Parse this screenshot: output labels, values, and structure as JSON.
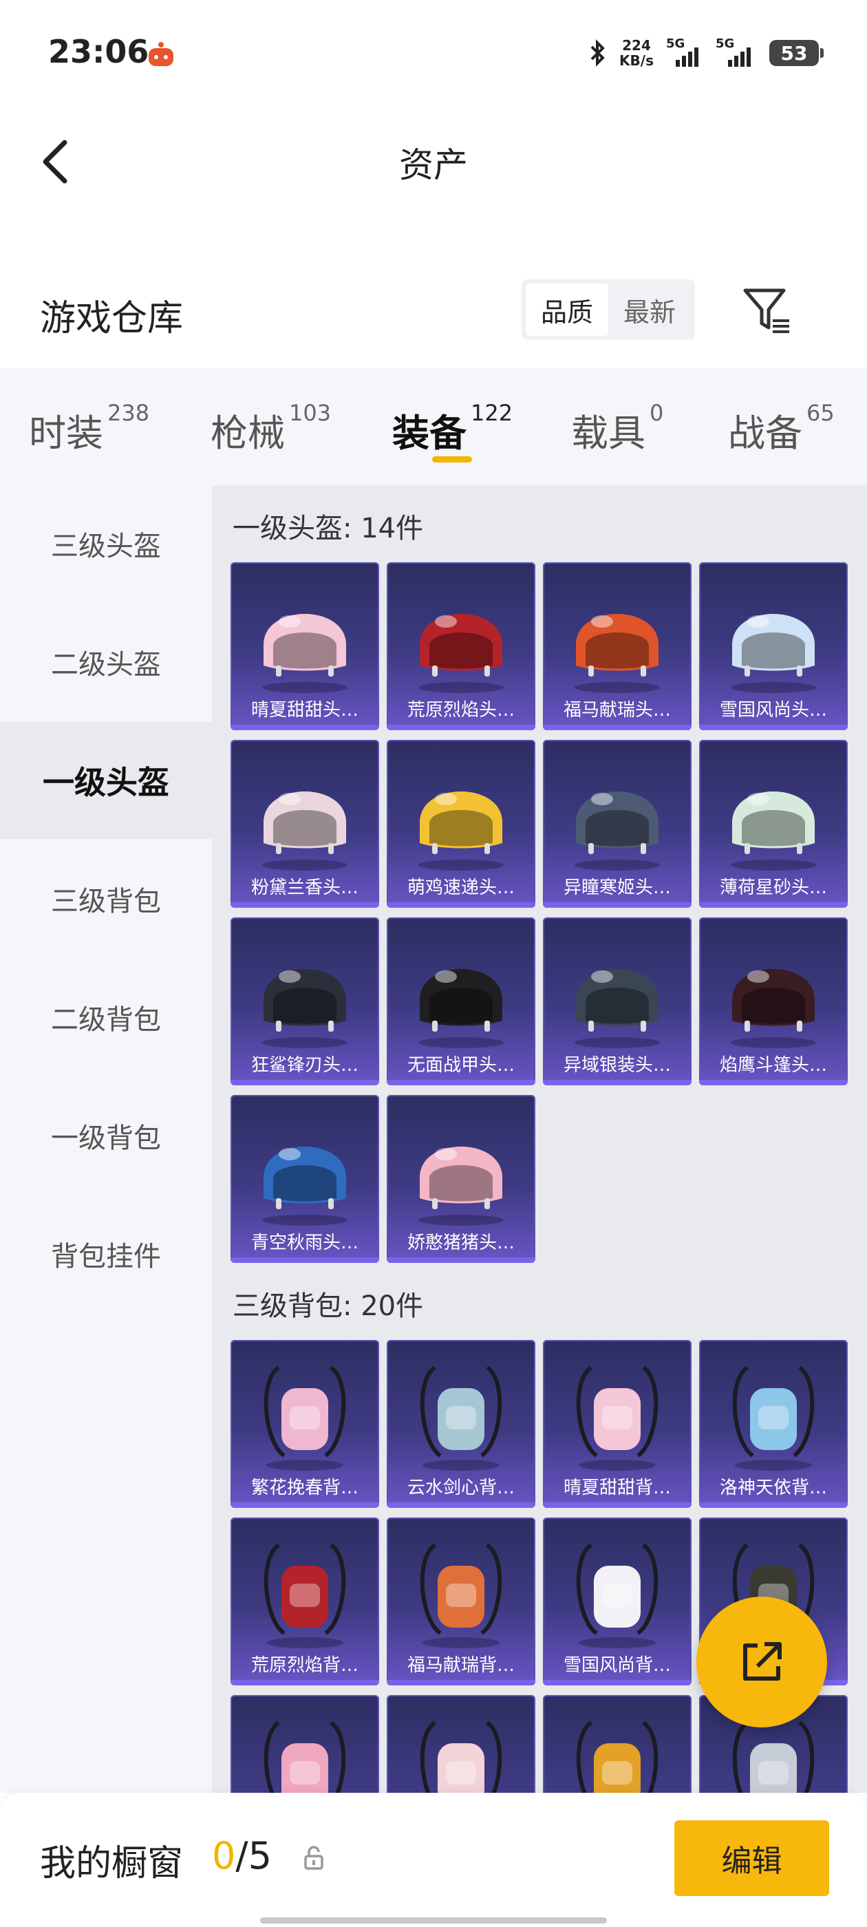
{
  "status_bar": {
    "time": "23:06",
    "speed_value": "224",
    "speed_unit": "KB/s",
    "sim1_label": "5G",
    "sim2_label": "5G",
    "battery": "53",
    "icons": [
      "app-notification-icon",
      "bluetooth-icon",
      "signal-icon",
      "battery-icon"
    ]
  },
  "header": {
    "title": "资产",
    "back_icon": "chevron-left-icon"
  },
  "warehouse": {
    "title": "游戏仓库",
    "sort_options": [
      "品质",
      "最新"
    ],
    "active_sort": "品质",
    "filter_icon": "filter-icon"
  },
  "tabs": [
    {
      "label": "时装",
      "count": "238"
    },
    {
      "label": "枪械",
      "count": "103"
    },
    {
      "label": "装备",
      "count": "122"
    },
    {
      "label": "载具",
      "count": "0"
    },
    {
      "label": "战备",
      "count": "65"
    }
  ],
  "active_tab": "装备",
  "sidebar": {
    "items": [
      "三级头盔",
      "二级头盔",
      "一级头盔",
      "三级背包",
      "二级背包",
      "一级背包",
      "背包挂件"
    ],
    "active": "一级头盔"
  },
  "sections": [
    {
      "title": "一级头盔: 14件",
      "items": [
        {
          "name": "晴夏甜甜头…",
          "kind": "helmet",
          "color": "#f4c6d6"
        },
        {
          "name": "荒原烈焰头…",
          "kind": "helmet",
          "color": "#b5232a"
        },
        {
          "name": "福马献瑞头…",
          "kind": "helmet",
          "color": "#e0542a"
        },
        {
          "name": "雪国风尚头…",
          "kind": "helmet",
          "color": "#cfe1f4"
        },
        {
          "name": "粉黛兰香头…",
          "kind": "helmet",
          "color": "#ead6dc"
        },
        {
          "name": "萌鸡速递头…",
          "kind": "helmet",
          "color": "#f2c234"
        },
        {
          "name": "异瞳寒姬头…",
          "kind": "helmet",
          "color": "#4d5a73"
        },
        {
          "name": "薄荷星砂头…",
          "kind": "helmet",
          "color": "#d6eadc"
        },
        {
          "name": "狂鲨锋刃头…",
          "kind": "helmet",
          "color": "#2c2f3a"
        },
        {
          "name": "无面战甲头…",
          "kind": "helmet",
          "color": "#1f1f22"
        },
        {
          "name": "异域银装头…",
          "kind": "helmet",
          "color": "#3a4654"
        },
        {
          "name": "焰鹰斗篷头…",
          "kind": "helmet",
          "color": "#3a1d22"
        },
        {
          "name": "青空秋雨头…",
          "kind": "helmet",
          "color": "#2f6cc0"
        },
        {
          "name": "娇憨猪猪头…",
          "kind": "helmet",
          "color": "#f3b6c6"
        }
      ]
    },
    {
      "title": "三级背包: 20件",
      "items": [
        {
          "name": "繁花挽春背…",
          "kind": "backpack",
          "color": "#f0b7d0"
        },
        {
          "name": "云水剑心背…",
          "kind": "backpack",
          "color": "#a7c6d4"
        },
        {
          "name": "晴夏甜甜背…",
          "kind": "backpack",
          "color": "#f4c6d6"
        },
        {
          "name": "洛神天依背…",
          "kind": "backpack",
          "color": "#8cc7ea"
        },
        {
          "name": "荒原烈焰背…",
          "kind": "backpack",
          "color": "#b5232a"
        },
        {
          "name": "福马献瑞背…",
          "kind": "backpack",
          "color": "#e0703a"
        },
        {
          "name": "雪国风尚背…",
          "kind": "backpack",
          "color": "#f2f2f6"
        },
        {
          "name": "",
          "kind": "backpack",
          "color": "#3b3a30"
        },
        {
          "name": "",
          "kind": "backpack",
          "color": "#f0a7c0"
        },
        {
          "name": "",
          "kind": "backpack",
          "color": "#f1d3d8"
        },
        {
          "name": "",
          "kind": "backpack",
          "color": "#e3a128"
        },
        {
          "name": "",
          "kind": "backpack",
          "color": "#c7cdd6"
        }
      ]
    }
  ],
  "fab": {
    "icon": "share-export-icon"
  },
  "bottom_bar": {
    "label": "我的橱窗",
    "current": "0",
    "separator": "/",
    "total": "5",
    "lock_icon": "lock-icon",
    "edit_label": "编辑"
  },
  "colors": {
    "accent": "#f5b400",
    "card_bg": "#3e3b84",
    "card_edge": "#7a63e8"
  }
}
